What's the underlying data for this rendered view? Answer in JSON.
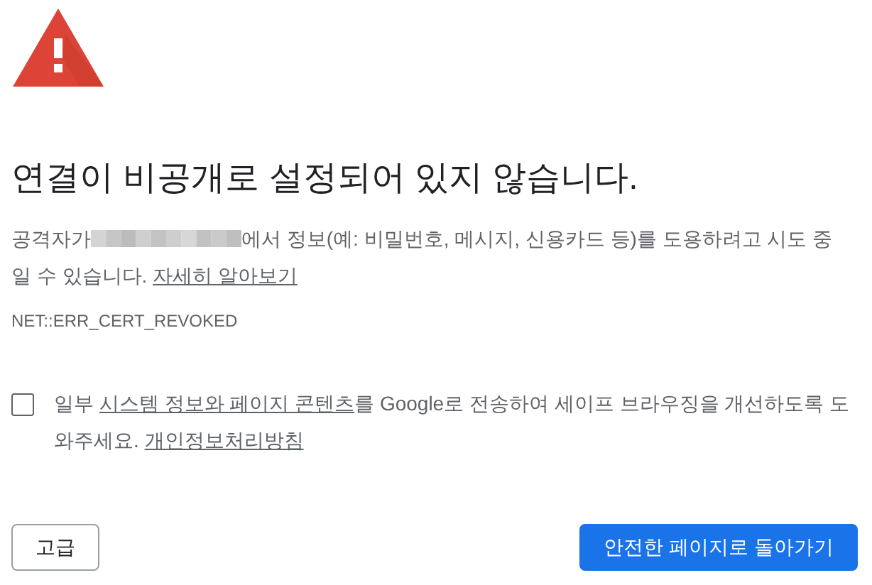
{
  "heading": "연결이 비공개로 설정되어 있지 않습니다.",
  "description": {
    "before": "공격자가",
    "redacted": true,
    "after": "에서 정보(예: 비밀번호, 메시지, 신용카드 등)를 도용하려고 시도 중일 수 있습니다. ",
    "link": "자세히 알아보기"
  },
  "error_code": "NET::ERR_CERT_REVOKED",
  "opt_in": {
    "checked": false,
    "parts": [
      {
        "kind": "text",
        "text": "일부 "
      },
      {
        "kind": "link",
        "text": "시스템 정보와 페이지 콘텐츠"
      },
      {
        "kind": "text",
        "text": "를 Google로 전송하여 세이프 브라우징을 개선하도록 도와주세요. "
      },
      {
        "kind": "link",
        "text": "개인정보처리방침"
      }
    ]
  },
  "buttons": [
    {
      "kind": "secondary",
      "label": "고급"
    },
    {
      "kind": "primary",
      "label": "안전한 페이지로 돌아가기"
    }
  ]
}
